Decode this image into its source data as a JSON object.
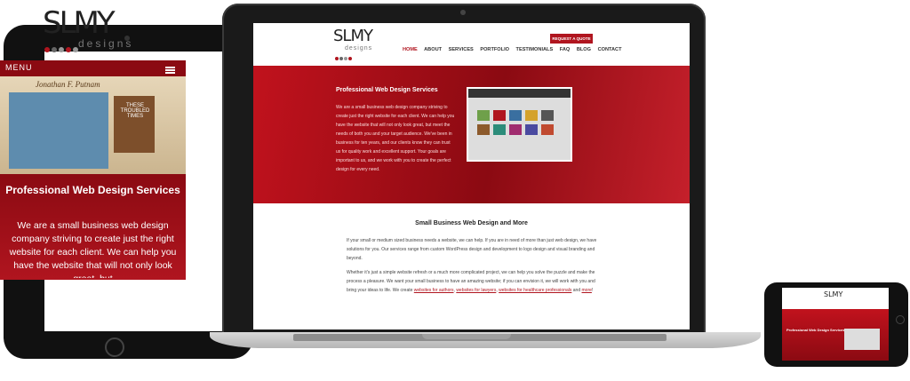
{
  "brand": {
    "logo_main": "SLMY",
    "logo_sub": "designs",
    "dot_colors": [
      "#b0151f",
      "#666666",
      "#999999",
      "#b0151f",
      "#999999"
    ]
  },
  "colors": {
    "accent": "#b0151f",
    "accent_dark": "#8b0a12"
  },
  "laptop": {
    "nav": [
      "HOME",
      "ABOUT",
      "SERVICES",
      "PORTFOLIO",
      "TESTIMONIALS",
      "FAQ",
      "BLOG",
      "CONTACT"
    ],
    "quote_button": "REQUEST A QUOTE",
    "hero_title": "Professional Web Design Services",
    "hero_text": "We are a small business web design company striving to create just the right website for each client. We can help you have the website that will not only look great, but meet the needs of both you and your target audience. We've been in business for ten years, and our clients know they can trust us for quality work and excellent support. Your goals are important to us, and we work with you to create the perfect design for every need.",
    "body_title": "Small Business Web Design and More",
    "body_p1": "If your small or medium sized business needs a website, we can help. If you are in need of more than just web design, we have solutions for you. Our services range from custom WordPress design and development to logo design and visual branding and beyond.",
    "body_p2": "Whether it's just a simple website refresh or a much more complicated project, we can help you solve the puzzle and make the process a pleasure. We want your small business to have an amazing website; if you can envision it, we will work with you and bring your ideas to life. We create",
    "links": [
      "websites for authors",
      "websites for lawyers",
      "websites for healthcare professionals"
    ],
    "link_sep_1": ", ",
    "link_sep_2": " and ",
    "more_link": "more",
    "end_mark": "!"
  },
  "tablet": {
    "menu_label": "MENU",
    "shot_name": "Jonathan F. Putnam",
    "book_title": "THESE TROUBLED TIMES",
    "hero_title": "Professional Web Design Services",
    "hero_text": "We are a small business web design company striving to create just the right website for each client. We can help you have the website that will not only look great, but"
  },
  "phone": {
    "hero_title": "Professional Web Design Services"
  },
  "icons": [
    "hamburger-menu-icon"
  ]
}
